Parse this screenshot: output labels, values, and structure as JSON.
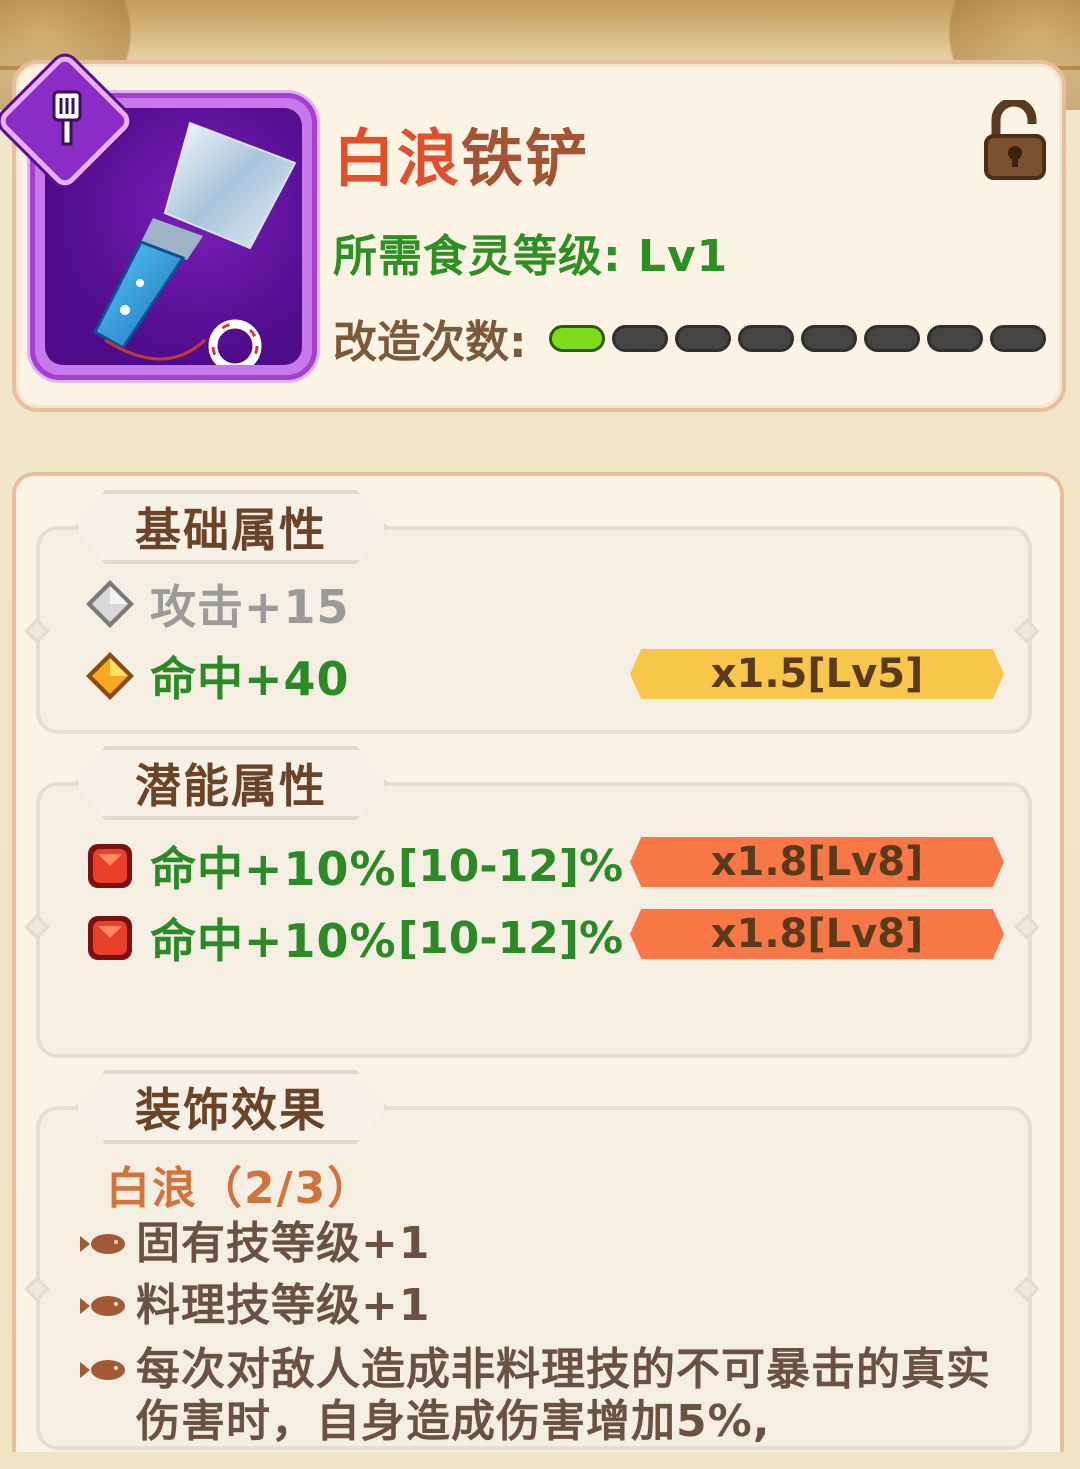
{
  "item": {
    "name_part1": "白浪",
    "name_part2": "铁铲",
    "level_requirement": "所需食灵等级:  Lv1",
    "modification_label": "改造次数:",
    "modification_count": 1,
    "modification_max": 8,
    "lock_state": "unlocked"
  },
  "basic_section": {
    "title": "基础属性",
    "stats": [
      {
        "gem": "silver",
        "text": "攻击+15",
        "multiplier": ""
      },
      {
        "gem": "gold",
        "text": "命中+40",
        "multiplier": "x1.5[Lv5]"
      }
    ]
  },
  "potential_section": {
    "title": "潜能属性",
    "stats": [
      {
        "gem": "red",
        "text": "命中+10%",
        "range": "[10-12]%",
        "multiplier": "x1.8[Lv8]"
      },
      {
        "gem": "red",
        "text": "命中+10%",
        "range": "[10-12]%",
        "multiplier": "x1.8[Lv8]"
      }
    ]
  },
  "decoration_section": {
    "title": "装饰效果",
    "set_name": "白浪（2/3）",
    "effects": [
      "固有技等级+1",
      "料理技等级+1",
      "每次对敌人造成非料理技的不可暴击的真实伤害时，自身造成伤害增加5%,"
    ]
  },
  "colors": {
    "name_accent": "#e0502c",
    "name_secondary": "#a25434",
    "level_green": "#2c8a26",
    "multiplier_yellow": "#f7c64b",
    "multiplier_orange": "#f77747",
    "rarity_purple": "#a43fd1"
  },
  "icons": {
    "type_badge": "spatula-icon",
    "lock": "unlock-icon",
    "gem_silver": "silver-gem-icon",
    "gem_gold": "gold-gem-icon",
    "gem_red": "red-gem-icon",
    "bullet": "fish-bullet-icon"
  }
}
